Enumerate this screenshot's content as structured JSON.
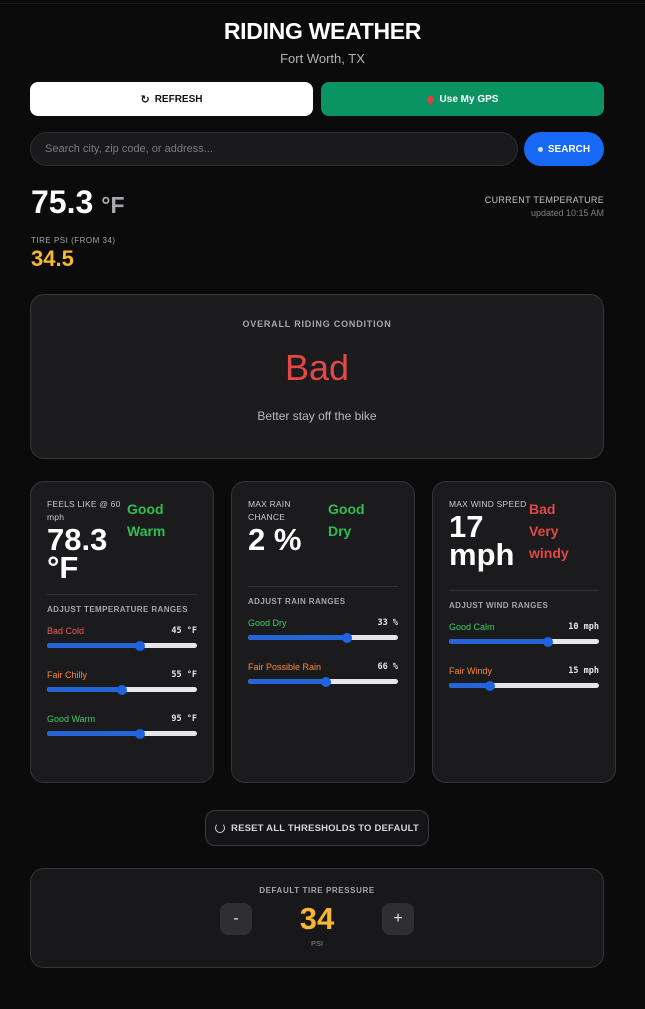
{
  "header": {
    "title": "RIDING WEATHER",
    "location": "Fort Worth, TX"
  },
  "actions": {
    "refresh_label": "REFRESH",
    "gps_label": "Use My GPS"
  },
  "search": {
    "placeholder": "Search city, zip code, or address...",
    "value": "",
    "button_label": "SEARCH"
  },
  "current": {
    "temperature": "75.3",
    "unit": "°F",
    "label": "CURRENT TEMPERATURE",
    "updated": "updated 10:15 AM",
    "tire_label": "TIRE PSI (FROM 34)",
    "tire_psi": "34.5"
  },
  "overall": {
    "label": "OVERALL RIDING CONDITION",
    "status": "Bad",
    "description": "Better stay off the bike"
  },
  "cards": {
    "temp": {
      "metric_label": "FEELS LIKE @ 60 mph",
      "value": "78.3 °F",
      "status_main": "Good",
      "status_sub": "Warm",
      "adjust_label": "ADJUST TEMPERATURE RANGES",
      "sliders": [
        {
          "label": "Bad Cold",
          "value": "45 °F",
          "fraction": 0.62
        },
        {
          "label": "Fair Chilly",
          "value": "55 °F",
          "fraction": 0.5
        },
        {
          "label": "Good Warm",
          "value": "95 °F",
          "fraction": 0.62
        }
      ]
    },
    "rain": {
      "metric_label": "MAX RAIN CHANCE",
      "value": "2 %",
      "status_main": "Good",
      "status_sub": "Dry",
      "adjust_label": "ADJUST RAIN RANGES",
      "sliders": [
        {
          "label": "Good Dry",
          "value": "33 %",
          "fraction": 0.66
        },
        {
          "label": "Fair Possible Rain",
          "value": "66 %",
          "fraction": 0.52
        }
      ]
    },
    "wind": {
      "metric_label": "MAX WIND SPEED",
      "value": "17 mph",
      "status_main": "Bad",
      "status_sub": "Very windy",
      "adjust_label": "ADJUST WIND RANGES",
      "sliders": [
        {
          "label": "Good Calm",
          "value": "10 mph",
          "fraction": 0.66
        },
        {
          "label": "Fair Windy",
          "value": "15 mph",
          "fraction": 0.27
        }
      ]
    }
  },
  "reset_label": "RESET ALL THRESHOLDS TO DEFAULT",
  "tire_pressure": {
    "label": "DEFAULT TIRE PRESSURE",
    "value": "34",
    "unit": "PSI",
    "minus": "-",
    "plus": "+"
  },
  "colors": {
    "accent": "#1769f5",
    "gps": "#0a9464",
    "bad": "#e34848",
    "good": "#2fbf4f",
    "psi": "#f7b731"
  }
}
